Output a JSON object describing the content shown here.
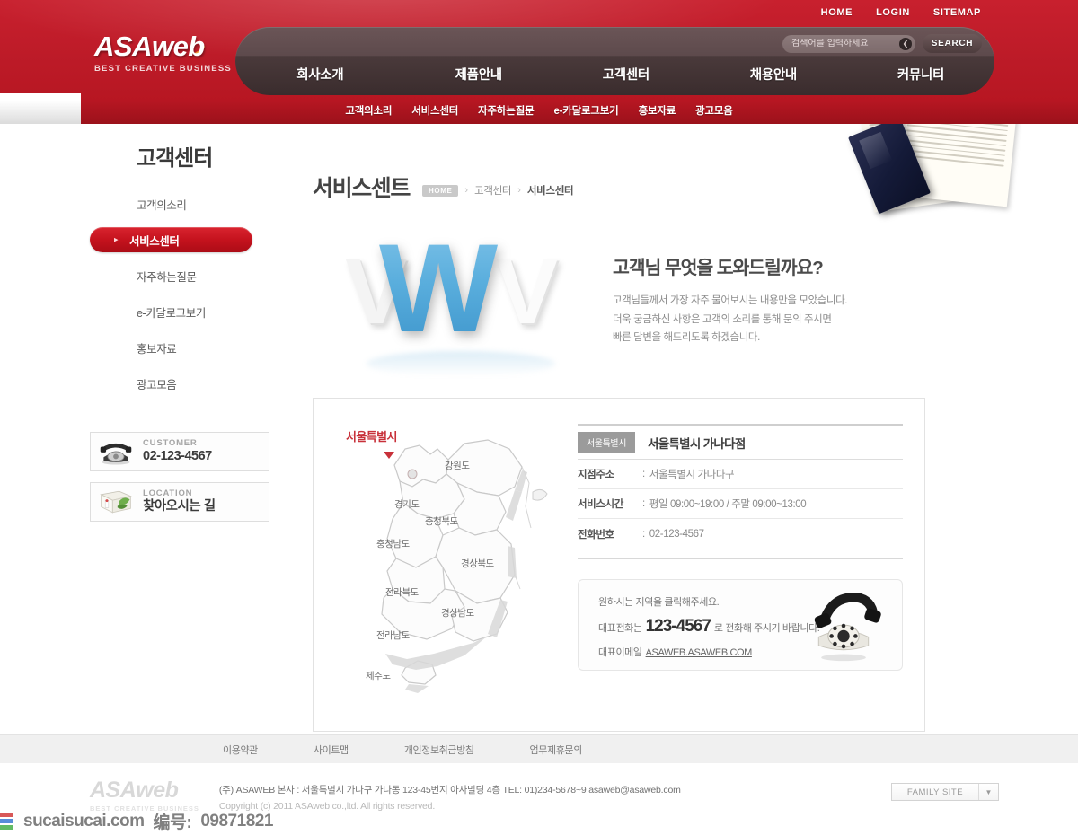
{
  "header": {
    "utility_nav": [
      {
        "label": "HOME"
      },
      {
        "label": "LOGIN"
      },
      {
        "label": "SITEMAP"
      }
    ],
    "logo": {
      "main": "ASAweb",
      "tagline": "BEST CREATIVE BUSINESS"
    },
    "search": {
      "placeholder": "검색어를 입력하세요",
      "value": "",
      "go_icon": "❮",
      "button_label": "SEARCH"
    },
    "main_nav": [
      {
        "label": "회사소개"
      },
      {
        "label": "제품안내"
      },
      {
        "label": "고객센터"
      },
      {
        "label": "채용안내"
      },
      {
        "label": "커뮤니티"
      }
    ],
    "sub_nav": [
      {
        "label": "고객의소리"
      },
      {
        "label": "서비스센터"
      },
      {
        "label": "자주하는질문"
      },
      {
        "label": "e-카달로그보기"
      },
      {
        "label": "홍보자료"
      },
      {
        "label": "광고모음"
      }
    ]
  },
  "sidebar": {
    "title": "고객센터",
    "items": [
      {
        "label": "고객의소리",
        "active": false
      },
      {
        "label": "서비스센터",
        "active": true
      },
      {
        "label": "자주하는질문",
        "active": false
      },
      {
        "label": "e-카달로그보기",
        "active": false
      },
      {
        "label": "홍보자료",
        "active": false
      },
      {
        "label": "광고모음",
        "active": false
      }
    ],
    "boxes": [
      {
        "label": "CUSTOMER",
        "value": "02-123-4567",
        "icon": "rotary-phone-icon"
      },
      {
        "label": "LOCATION",
        "value": "찾아오시는 길",
        "icon": "notebook-icon"
      }
    ]
  },
  "main": {
    "page_title": "서비스센트",
    "breadcrumb": {
      "home_label": "HOME",
      "separator": "›",
      "items": [
        {
          "label": "고객센터",
          "current": false
        },
        {
          "label": "서비스센터",
          "current": true
        }
      ]
    },
    "hero": {
      "art_letters": {
        "left": "V",
        "center": "W",
        "right": "V"
      },
      "heading": "고객님 무엇을 도와드릴까요?",
      "lines": [
        "고객님들께서 가장 자주 물어보시는 내용만을 모았습니다.",
        "더욱 궁금하신 사항은 고객의 소리를 통해 문의 주시면",
        "빠른 답변을 해드리도록 하겠습니다."
      ]
    },
    "map": {
      "title_region": "서울특별시",
      "regions": [
        {
          "label": "강원도"
        },
        {
          "label": "경기도"
        },
        {
          "label": "충청북도"
        },
        {
          "label": "충청남도"
        },
        {
          "label": "경상북도"
        },
        {
          "label": "전라북도"
        },
        {
          "label": "경상남도"
        },
        {
          "label": "전라남도"
        },
        {
          "label": "제주도"
        }
      ]
    },
    "branch": {
      "tag": "서울특별시",
      "name": "서울특별시 가나다점",
      "rows": [
        {
          "key": "지점주소",
          "sep": ":",
          "value": "서울특별시 가나다구"
        },
        {
          "key": "서비스시간",
          "sep": ":",
          "value": "평일 09:00~19:00 / 주말 09:00~13:00"
        },
        {
          "key": "전화번호",
          "sep": ":",
          "value": "02-123-4567"
        }
      ]
    },
    "callbox": {
      "line1": "원하시는 지역을 클릭해주세요.",
      "line2_pre": "대표전화는",
      "line2_number": "123-4567",
      "line2_post": "로 전화해 주시기 바랍니다.",
      "line3_pre": "대표이메일",
      "line3_mail": "ASAWEB.ASAWEB.COM"
    }
  },
  "footer": {
    "nav": [
      {
        "label": "이용약관"
      },
      {
        "label": "사이트맵"
      },
      {
        "label": "개인정보취급방침"
      },
      {
        "label": "업무제휴문의"
      }
    ],
    "logo": {
      "main": "ASAweb",
      "tagline": "BEST CREATIVE BUSINESS"
    },
    "address": "(주) ASAWEB  본사 : 서울특별시 가나구 가나동 123-45번지  아사빌딩 4층 TEL: 01)234-5678~9  asaweb@asaweb.com",
    "copyright": "Copyright (c) 2011 ASAweb co.,ltd. All rights reserved.",
    "family_site": {
      "label": "FAMILY SITE",
      "arrow": "▼"
    }
  },
  "watermark": {
    "site": "sucaisucai.com",
    "code_label": "编号:",
    "code": "09871821"
  },
  "colors": {
    "brand_red": "#c8202e",
    "nav_dark": "#4a3a3b",
    "accent_blue": "#5aaedd",
    "seoul_red": "#c8313a",
    "tag_gray": "#9b9b9b"
  }
}
